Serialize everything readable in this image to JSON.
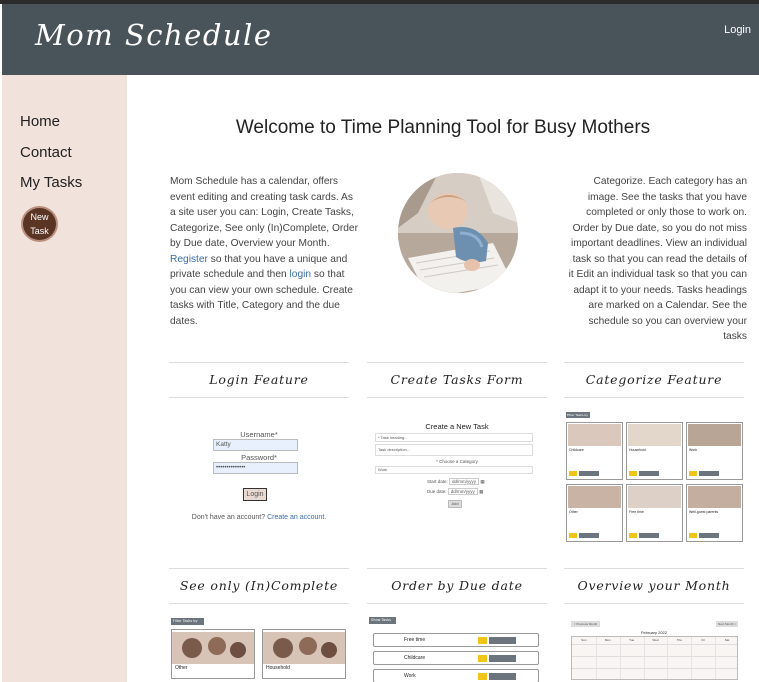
{
  "header": {
    "brand": "Mom Schedule",
    "login": "Login"
  },
  "sidebar": {
    "items": [
      {
        "label": "Home"
      },
      {
        "label": "Contact"
      },
      {
        "label": "My Tasks"
      }
    ],
    "new_task": [
      "New",
      "Task"
    ]
  },
  "main": {
    "title": "Welcome to Time Planning Tool for Busy Mothers",
    "intro_left": {
      "text1": "Mom Schedule has a calendar, offers event editing and creating task cards. As a site user you can: Login, Create Tasks, Categorize, See only (In)Complete, Order by Due date, Overview your Month. ",
      "register": "Register",
      "text2": " so that you have a unique and private schedule and then ",
      "login": "login",
      "text3": " so that you can view your own schedule. Create tasks with Title, Category and the due dates."
    },
    "intro_right": "Categorize. Each category has an image. See the tasks that you have completed or only those to work on. Order by Due date, so you do not miss important deadlines. View an individual task so that you can read the details of it Edit an individual task so that you can adapt it to your needs. Tasks headings are marked on a Calendar. See the schedule so you can overview your tasks"
  },
  "features": [
    {
      "title": "Login Feature"
    },
    {
      "title": "Create Tasks Form"
    },
    {
      "title": "Categorize Feature"
    },
    {
      "title": "See only (In)Complete"
    },
    {
      "title": "Order by Due date"
    },
    {
      "title": "Overview your Month"
    }
  ],
  "login_demo": {
    "username_label": "Username*",
    "username_value": "Katty",
    "password_label": "Password*",
    "password_value": "••••••••••••••",
    "button": "Login",
    "no_account": "Don't have an account? ",
    "create_link": "Create an account."
  },
  "create_demo": {
    "title": "Create a New Task",
    "heading_ph": "* Task heading...",
    "desc_ph": "Task description...",
    "category_ph": "* Choose a Category",
    "select_value": "Work",
    "start_label": "Start date:",
    "start_value": "dd/mm/yyyy",
    "due_label": "Due date:",
    "due_value": "dd/mm/yyyy",
    "button": "Add"
  },
  "categorize_demo": {
    "filter": "Filter Tasks by",
    "cards": [
      {
        "name": "Childcare"
      },
      {
        "name": "Household"
      },
      {
        "name": "Work"
      },
      {
        "name": "Other"
      },
      {
        "name": "Free time"
      },
      {
        "name": "Well-guest parents"
      }
    ]
  },
  "complete_demo": {
    "filter": "Filter Tasks by",
    "cards": [
      {
        "name": "Other"
      },
      {
        "name": "Household"
      }
    ]
  },
  "order_demo": {
    "filter": "Show Tasks by",
    "rows": [
      {
        "label": "Free time"
      },
      {
        "label": "Childcare"
      },
      {
        "label": "Work"
      }
    ]
  },
  "month_demo": {
    "prev": "< Previous Month",
    "next": "Next Month >",
    "month": "February 2022",
    "days": [
      "Sun",
      "Mon",
      "Tue",
      "Wed",
      "Thu",
      "Fri",
      "Sat"
    ]
  },
  "colors": {
    "header": "#48535a",
    "sidebar": "#f1e2db",
    "new_task_button": "#5a3524",
    "link": "#3a6ea5"
  }
}
